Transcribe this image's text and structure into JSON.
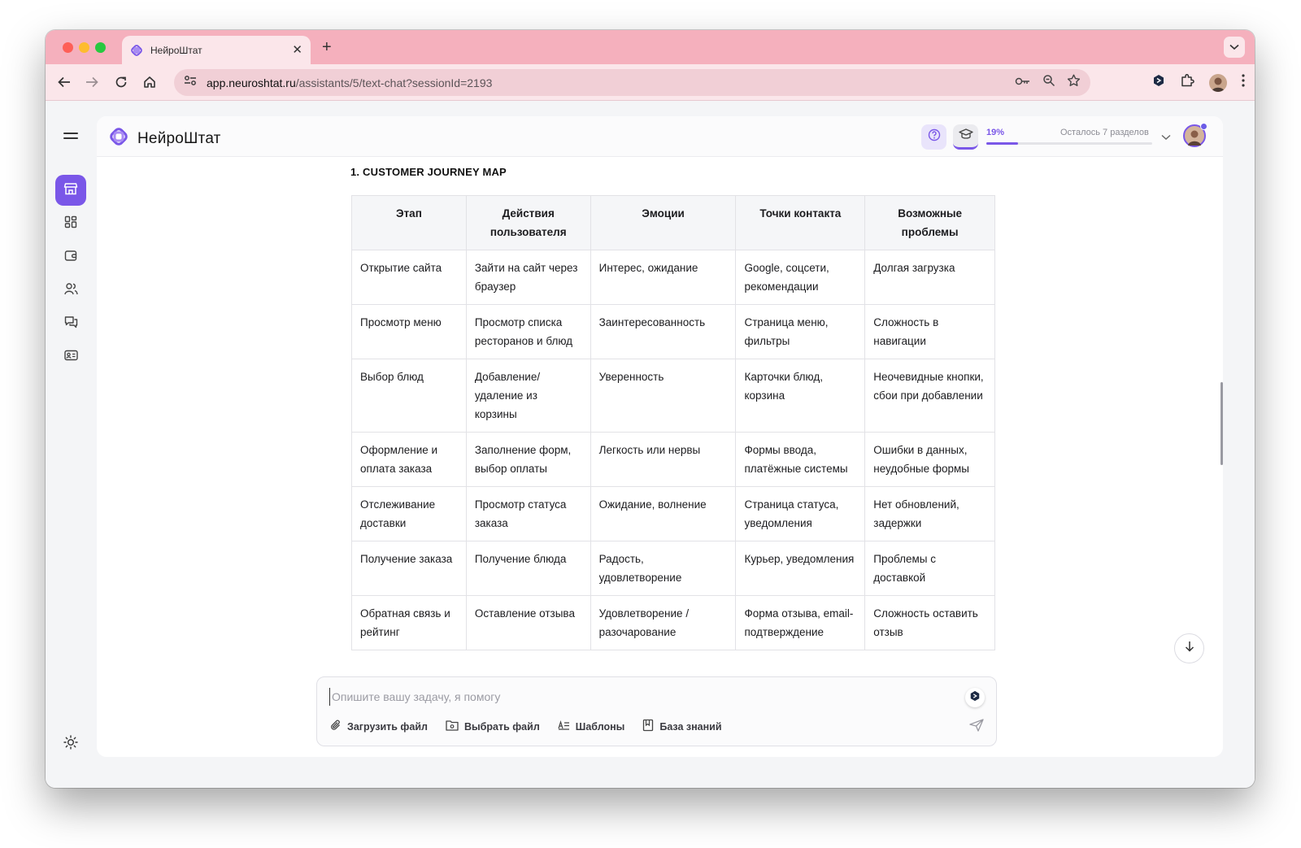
{
  "browser": {
    "tab_title": "НейроШтат",
    "url_host": "app.neuroshtat.ru",
    "url_path": "/assistants/5/text-chat?sessionId=2193"
  },
  "app": {
    "brand": "НейроШтат",
    "progress": {
      "percent_label": "19%",
      "percent": 19,
      "remaining_label": "Осталось 7 разделов"
    }
  },
  "sidebar": {
    "items": [
      {
        "icon": "store-icon",
        "active": true
      },
      {
        "icon": "dashboard-grid-icon",
        "active": false
      },
      {
        "icon": "wallet-icon",
        "active": false
      },
      {
        "icon": "users-icon",
        "active": false
      },
      {
        "icon": "chat-icon",
        "active": false
      },
      {
        "icon": "id-card-icon",
        "active": false
      }
    ],
    "theme_icon": "sun-icon"
  },
  "content": {
    "section_title": "1. CUSTOMER JOURNEY MAP",
    "table": {
      "headers": [
        "Этап",
        "Действия пользователя",
        "Эмоции",
        "Точки контакта",
        "Возможные проблемы"
      ],
      "rows": [
        [
          "Открытие сайта",
          "Зайти на сайт через браузер",
          "Интерес, ожидание",
          "Google, соцсети, рекомендации",
          "Долгая загрузка"
        ],
        [
          "Просмотр меню",
          "Просмотр списка ресторанов и блюд",
          "Заинтересованность",
          "Страница меню, фильтры",
          "Сложность в навигации"
        ],
        [
          "Выбор блюд",
          "Добавление/ удаление из корзины",
          "Уверенность",
          "Карточки блюд, корзина",
          "Неочевидные кнопки, сбои при добавлении"
        ],
        [
          "Оформление и оплата заказа",
          "Заполнение форм, выбор оплаты",
          "Легкость или нервы",
          "Формы ввода, платёжные системы",
          "Ошибки в данных, неудобные формы"
        ],
        [
          "Отслеживание доставки",
          "Просмотр статуса заказа",
          "Ожидание, волнение",
          "Страница статуса, уведомления",
          "Нет обновлений, задержки"
        ],
        [
          "Получение заказа",
          "Получение блюда",
          "Радость, удовлетворение",
          "Курьер, уведомления",
          "Проблемы с доставкой"
        ],
        [
          "Обратная связь и рейтинг",
          "Оставление отзыва",
          "Удовлетворение / разочарование",
          "Форма отзыва, email-подтверждение",
          "Сложность оставить отзыв"
        ]
      ]
    }
  },
  "composer": {
    "placeholder": "Опишите вашу задачу, я помогу",
    "value": "",
    "actions": {
      "upload": "Загрузить файл",
      "choose": "Выбрать файл",
      "templates": "Шаблоны",
      "knowledge": "База знаний"
    }
  },
  "colors": {
    "accent": "#7a57e8",
    "tabbar": "#f5b0bd",
    "toolbar": "#fbe6ea"
  }
}
